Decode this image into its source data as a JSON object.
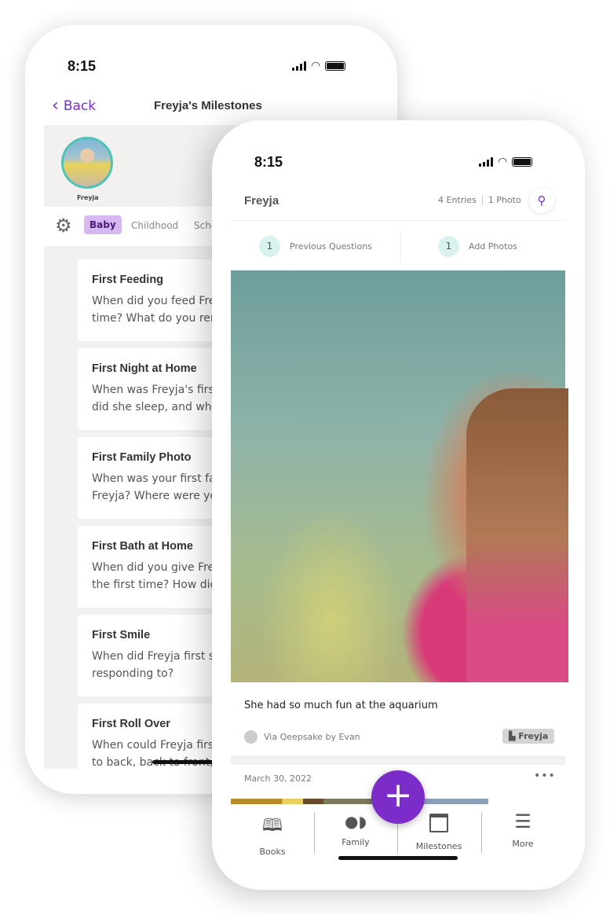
{
  "back_phone": {
    "status_time": "8:15",
    "back_label": "Back",
    "title": "Freyja's Milestones",
    "avatar_name": "Freyja",
    "tabs": [
      "Baby",
      "Childhood",
      "Scho"
    ],
    "cards": [
      {
        "title": "First Feeding",
        "text": [
          "When did you feed Freyja",
          "time? What do you remem"
        ]
      },
      {
        "title": "First Night at Home",
        "text": [
          "When was Freyja's first nig",
          "did she sleep, and what ki"
        ]
      },
      {
        "title": "First Family Photo",
        "text": [
          "When was your first family",
          "Freyja? Where were you, a"
        ]
      },
      {
        "title": "First Bath at Home",
        "text": [
          "When did you give Freyja",
          "the first time? How did it g"
        ]
      },
      {
        "title": "First Smile",
        "text": [
          "When did Freyja first smile",
          "responding to?"
        ]
      },
      {
        "title": "First Roll Over",
        "text": [
          "When could Freyja first ro",
          "to back, back to front, or b"
        ]
      }
    ]
  },
  "front_phone": {
    "status_time": "8:15",
    "title": "Freyja",
    "entries": "4 Entries",
    "photos": "1 Photo",
    "prev_questions": {
      "count": "1",
      "label": "Previous Questions"
    },
    "add_photos": {
      "count": "1",
      "label": "Add Photos"
    },
    "caption": "She had so much fun at the aquarium",
    "via": "Via Qeepsake by Evan",
    "book_tag": "Freyja",
    "date": "March 30, 2022",
    "nav": [
      "Books",
      "Family",
      "Milestones",
      "More"
    ]
  },
  "colors": {
    "accent": "#7b2cc9",
    "teal": "#4fc3b8",
    "badge_bg": "#d7b8f3"
  }
}
